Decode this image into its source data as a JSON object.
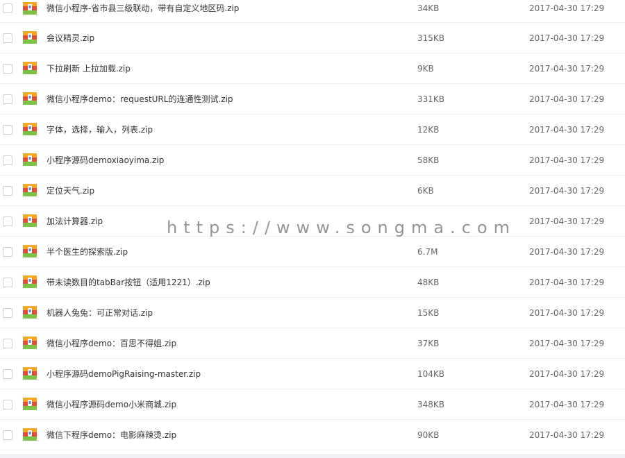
{
  "files": [
    {
      "name": "微信小程序-省市县三级联动，带有自定义地区码.zip",
      "size": "34KB",
      "date": "2017-04-30 17:29"
    },
    {
      "name": "会议精灵.zip",
      "size": "315KB",
      "date": "2017-04-30 17:29"
    },
    {
      "name": "下拉刷新 上拉加载.zip",
      "size": "9KB",
      "date": "2017-04-30 17:29"
    },
    {
      "name": "微信小程序demo：requestURL的连通性测试.zip",
      "size": "331KB",
      "date": "2017-04-30 17:29"
    },
    {
      "name": "字体，选择，输入，列表.zip",
      "size": "12KB",
      "date": "2017-04-30 17:29"
    },
    {
      "name": "小程序源码demoxiaoyima.zip",
      "size": "58KB",
      "date": "2017-04-30 17:29"
    },
    {
      "name": "定位天气.zip",
      "size": "6KB",
      "date": "2017-04-30 17:29"
    },
    {
      "name": "加法计算器.zip",
      "size": "",
      "date": "2017-04-30 17:29"
    },
    {
      "name": "半个医生的探索版.zip",
      "size": "6.7M",
      "date": "2017-04-30 17:29"
    },
    {
      "name": "带未读数目的tabBar按钮（适用1221）.zip",
      "size": "48KB",
      "date": "2017-04-30 17:29"
    },
    {
      "name": "机器人兔兔：可正常对话.zip",
      "size": "15KB",
      "date": "2017-04-30 17:29"
    },
    {
      "name": "微信小程序demo：百思不得姐.zip",
      "size": "37KB",
      "date": "2017-04-30 17:29"
    },
    {
      "name": "小程序源码demoPigRaising-master.zip",
      "size": "104KB",
      "date": "2017-04-30 17:29"
    },
    {
      "name": "微信小程序源码demo小米商城.zip",
      "size": "348KB",
      "date": "2017-04-30 17:29"
    },
    {
      "name": "微信下程序demo：电影麻辣烫.zip",
      "size": "90KB",
      "date": "2017-04-30 17:29"
    }
  ],
  "watermark": "https://www.songma.com",
  "icons": {
    "file": "zip-archive-icon",
    "checkbox": "checkbox-icon"
  },
  "colors": {
    "icon_orange": "#f5a623",
    "icon_green": "#7cc142",
    "icon_red": "#e04b3a",
    "icon_blue": "#4a90d9"
  }
}
